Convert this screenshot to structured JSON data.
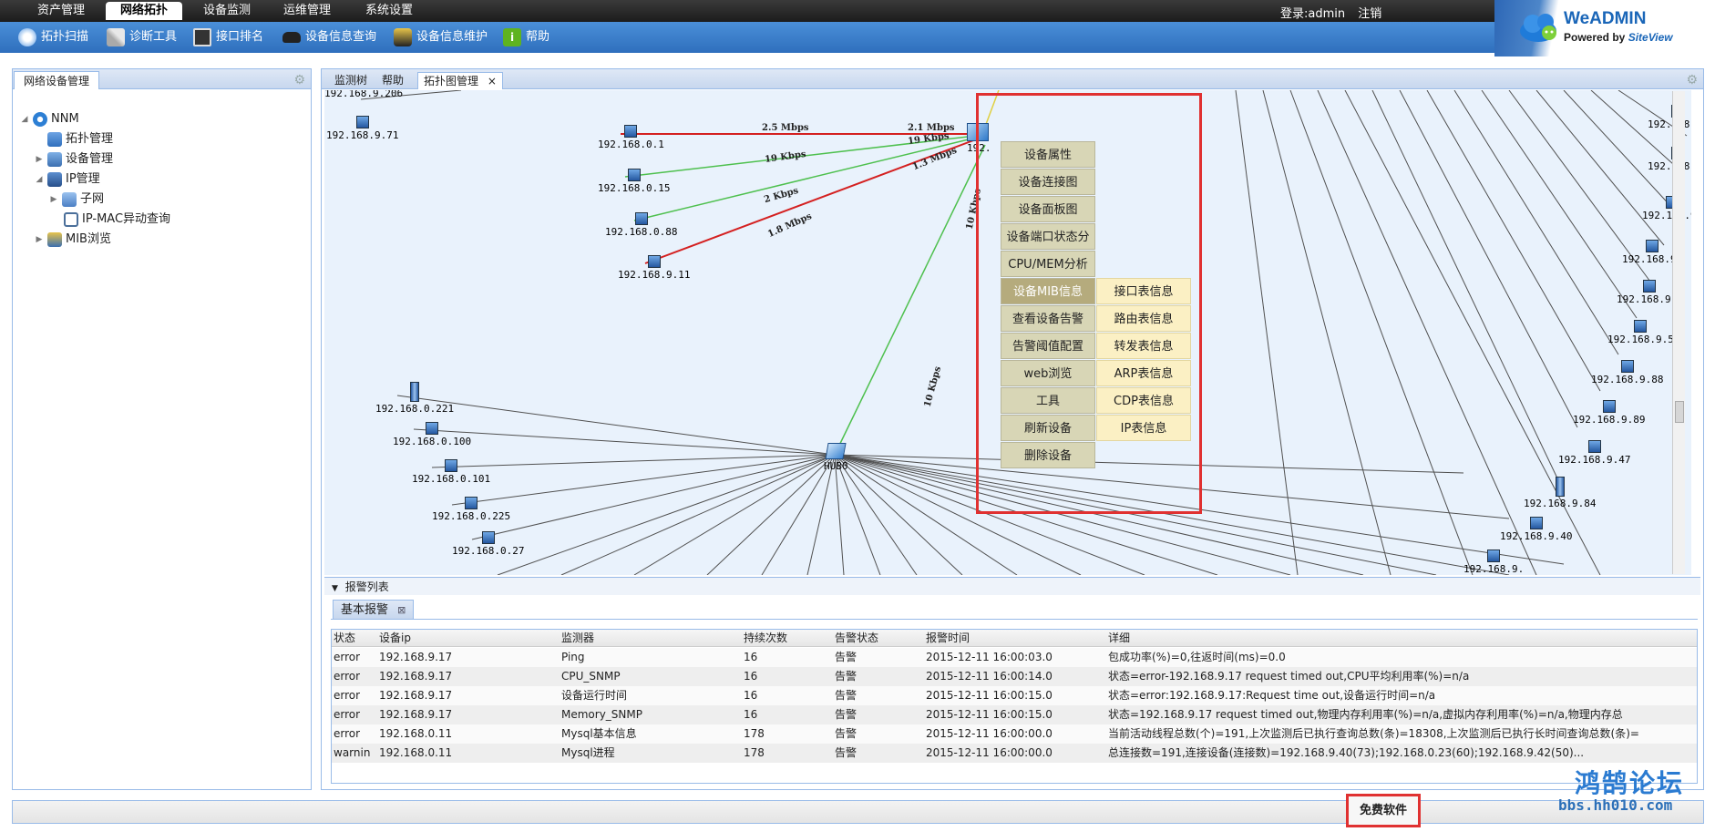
{
  "menu": {
    "tabs": [
      "资产管理",
      "网络拓扑",
      "设备监测",
      "运维管理",
      "系统设置"
    ],
    "active_tab": "网络拓扑",
    "login_label": "登录:admin",
    "logout_label": "注销"
  },
  "toolbar": {
    "items": [
      "拓扑扫描",
      "诊断工具",
      "接口排名",
      "设备信息查询",
      "设备信息维护",
      "帮助"
    ]
  },
  "brand": {
    "name": "WeADMIN",
    "powered_by": "Powered by",
    "powered_brand": "SiteView",
    "color": "#1a66b8"
  },
  "left_panel": {
    "title": "网络设备管理",
    "tree": {
      "root": "NNM",
      "topo": "拓扑管理",
      "device": "设备管理",
      "ip": "IP管理",
      "subnet": "子网",
      "ipmac": "IP-MAC异动查询",
      "mib": "MIB浏览"
    }
  },
  "main_tabs": [
    "监测树",
    "帮助",
    "拓扑图管理"
  ],
  "main_tab_close": "×",
  "topology": {
    "hub_label": "HUB0",
    "switch_label": "192.",
    "links": [
      "2.5 Mbps",
      "2.1 Mbps",
      "19 Kbps",
      "19 Kbps",
      "1.3 Mbps",
      "2 Kbps",
      "1.8 Mbps",
      "10 Kbps",
      "10 Kbps"
    ],
    "top_nodes": [
      "192.168.9.206",
      "192.168.9.71",
      "192.168.0.1",
      "192.168.0.15",
      "192.168.0.88",
      "192.168.9.11"
    ],
    "hub_nodes": [
      "192.168.0.221",
      "192.168.0.100",
      "192.168.0.101",
      "192.168.0.225",
      "192.168.0.27"
    ],
    "right_nodes": [
      "192.168.9.",
      "192.168.9.",
      "192.168.9.",
      "192.168.9.",
      "192.168.9.4",
      "192.168.9.5",
      "192.168.9.88",
      "192.168.9.89",
      "192.168.9.47",
      "192.168.9.84",
      "192.168.9.40",
      "192.168.9."
    ],
    "colors": {
      "red": "#d42020",
      "green": "#4ec04e",
      "gray": "#505050"
    }
  },
  "context_menu": {
    "items": [
      "设备属性",
      "设备连接图",
      "设备面板图",
      "设备端口状态分析",
      "CPU/MEM分析",
      "设备MIB信息",
      "查看设备告警",
      "告警阈值配置",
      "web浏览",
      "工具",
      "刷新设备",
      "删除设备"
    ],
    "highlighted": "设备MIB信息",
    "submenu": [
      "接口表信息",
      "路由表信息",
      "转发表信息",
      "ARP表信息",
      "CDP表信息",
      "IP表信息"
    ]
  },
  "alarm": {
    "section_title": "报警列表",
    "tab_label": "基本报警",
    "columns": [
      "状态",
      "设备ip",
      "监测器",
      "持续次数",
      "告警状态",
      "报警时间",
      "详细"
    ],
    "rows": [
      {
        "status": "error",
        "ip": "192.168.9.17",
        "monitor": "Ping",
        "count": "16",
        "alarm": "告警",
        "time": "2015-12-11 16:00:03.0",
        "detail": "包成功率(%)=0,往返时间(ms)=0.0"
      },
      {
        "status": "error",
        "ip": "192.168.9.17",
        "monitor": "CPU_SNMP",
        "count": "16",
        "alarm": "告警",
        "time": "2015-12-11 16:00:14.0",
        "detail": "状态=error-192.168.9.17 request timed out,CPU平均利用率(%)=n/a"
      },
      {
        "status": "error",
        "ip": "192.168.9.17",
        "monitor": "设备运行时间",
        "count": "16",
        "alarm": "告警",
        "time": "2015-12-11 16:00:15.0",
        "detail": "状态=error:192.168.9.17:Request time out,设备运行时间=n/a"
      },
      {
        "status": "error",
        "ip": "192.168.9.17",
        "monitor": "Memory_SNMP",
        "count": "16",
        "alarm": "告警",
        "time": "2015-12-11 16:00:15.0",
        "detail": "状态=192.168.9.17 request timed out,物理内存利用率(%)=n/a,虚拟内存利用率(%)=n/a,物理内存总"
      },
      {
        "status": "error",
        "ip": "192.168.0.11",
        "monitor": "Mysql基本信息",
        "count": "178",
        "alarm": "告警",
        "time": "2015-12-11 16:00:00.0",
        "detail": "当前活动线程总数(个)=191,上次监测后已执行查询总数(条)=18308,上次监测后已执行长时间查询总数(条)="
      },
      {
        "status": "warnin",
        "ip": "192.168.0.11",
        "monitor": "Mysql进程",
        "count": "178",
        "alarm": "告警",
        "time": "2015-12-11 16:00:00.0",
        "detail": "总连接数=191,连接设备(连接数)=192.168.9.40(73);192.168.0.23(60);192.168.9.42(50)..."
      }
    ]
  },
  "footer": {
    "free_software": "免费软件",
    "watermark_title": "鸿鹄论坛",
    "watermark_url": "bbs.hh010.com"
  }
}
